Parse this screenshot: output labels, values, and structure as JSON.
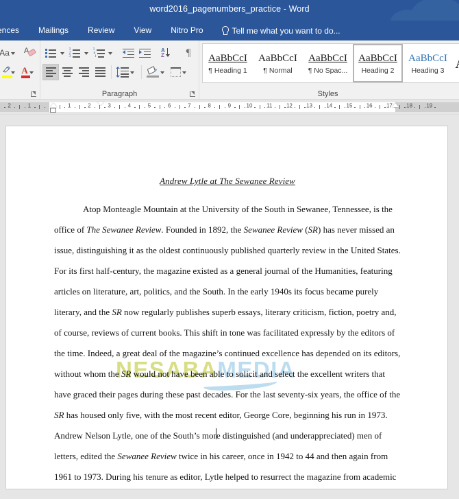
{
  "window": {
    "title": "word2016_pagenumbers_practice - Word"
  },
  "ribbon_tabs": [
    {
      "label": "ences",
      "name": "tab-references"
    },
    {
      "label": "Mailings",
      "name": "tab-mailings"
    },
    {
      "label": "Review",
      "name": "tab-review"
    },
    {
      "label": "View",
      "name": "tab-view"
    },
    {
      "label": "Nitro Pro",
      "name": "tab-nitro-pro"
    }
  ],
  "tell_me": {
    "label": "Tell me what you want to do...",
    "icon": "lightbulb-icon"
  },
  "font_group": {
    "label": "",
    "buttons": [
      {
        "name": "change-case-button",
        "icon": "change-case-icon",
        "label": "Aa"
      },
      {
        "name": "clear-formatting-button",
        "icon": "clear-formatting-icon",
        "label": ""
      },
      {
        "name": "text-highlight-color-button",
        "icon": "highlight-pen-icon",
        "label": ""
      },
      {
        "name": "font-color-button",
        "icon": "font-color-A-icon",
        "label": "A"
      }
    ]
  },
  "paragraph_group": {
    "label": "Paragraph",
    "row1": [
      {
        "name": "bullets-button",
        "icon": "bulleted-list-icon"
      },
      {
        "name": "numbering-button",
        "icon": "numbered-list-icon"
      },
      {
        "name": "multilevel-list-button",
        "icon": "multilevel-list-icon"
      },
      {
        "name": "decrease-indent-button",
        "icon": "decrease-indent-icon"
      },
      {
        "name": "increase-indent-button",
        "icon": "increase-indent-icon"
      },
      {
        "name": "sort-button",
        "icon": "sort-az-icon"
      },
      {
        "name": "show-formatting-marks-button",
        "icon": "pilcrow-icon"
      }
    ],
    "row2": [
      {
        "name": "align-left-button",
        "icon": "align-left-icon",
        "active": true
      },
      {
        "name": "align-center-button",
        "icon": "align-center-icon",
        "active": false
      },
      {
        "name": "align-right-button",
        "icon": "align-right-icon",
        "active": false
      },
      {
        "name": "justify-button",
        "icon": "justify-icon",
        "active": false
      },
      {
        "name": "line-spacing-button",
        "icon": "line-spacing-icon",
        "active": false
      },
      {
        "name": "shading-button",
        "icon": "shading-bucket-icon",
        "active": false
      },
      {
        "name": "borders-button",
        "icon": "borders-icon",
        "active": false
      }
    ]
  },
  "styles_group": {
    "label": "Styles",
    "items": [
      {
        "preview": "AaBbCcI",
        "name": "¶ Heading 1",
        "key": "h1",
        "selected": false
      },
      {
        "preview": "AaBbCcI",
        "name": "¶ Normal",
        "key": "normal",
        "selected": false
      },
      {
        "preview": "AaBbCcI",
        "name": "¶ No Spac...",
        "key": "nospace",
        "selected": false
      },
      {
        "preview": "AaBbCcI",
        "name": "Heading 2",
        "key": "h2",
        "selected": true
      },
      {
        "preview": "AaBbCcI",
        "name": "Heading 3",
        "key": "h3",
        "selected": false
      },
      {
        "preview": "A",
        "name": "",
        "key": "title",
        "selected": false
      }
    ]
  },
  "ruler": {
    "left_labels": [
      "2",
      "1"
    ],
    "right_labels": [
      "1",
      "2",
      "3",
      "4",
      "5",
      "6",
      "7",
      "8",
      "9",
      "10",
      "11",
      "12",
      "13",
      "14",
      "15",
      "16",
      "17",
      "18",
      "19"
    ],
    "markers": [
      "first-line-indent-marker",
      "hanging-indent-marker",
      "left-indent-marker",
      "right-indent-marker"
    ]
  },
  "document": {
    "title": "Andrew Lytle at The Sewanee Review",
    "paragraph_runs": [
      {
        "t": "Atop Monteagle Mountain at the University of the South in Sewanee, Tennessee, is the office of ",
        "i": false
      },
      {
        "t": "The Sewanee Review",
        "i": true
      },
      {
        "t": ". Founded in 1892, the ",
        "i": false
      },
      {
        "t": "Sewanee Review",
        "i": true
      },
      {
        "t": " (",
        "i": false
      },
      {
        "t": "SR",
        "i": true
      },
      {
        "t": ") has never missed an issue, distinguishing it as the oldest continuously published quarterly review in the United States. For its first half-century, the magazine existed as a general journal of the Humanities, featuring articles on literature, art, politics, and the South. In the early 1940s its focus became purely literary, and the ",
        "i": false
      },
      {
        "t": "SR",
        "i": true
      },
      {
        "t": " now regularly publishes superb essays, literary criticism, fiction, poetry and, of course, reviews of current books. This shift in tone was facilitated expressly by the editors of the time. Indeed, a great deal of the magazine’s continued excellence has depended on its editors, without whom the ",
        "i": false
      },
      {
        "t": "SR",
        "i": true
      },
      {
        "t": " would not have been able to solicit and select the excellent writers that have graced their pages during these past decades. For the last seventy-six years, the office of the ",
        "i": false
      },
      {
        "t": "SR",
        "i": true
      },
      {
        "t": " has housed only five, with the most recent editor, George Core, beginning his run in 1973. Andrew Nelson Lytle, one of the South’s more distinguished (and underappreciated) men of letters, edited the ",
        "i": false
      },
      {
        "t": "Sewanee Review",
        "i": true
      },
      {
        "t": " twice in his career, once in 1942 to 44 and then again from 1961 to 1973. During his tenure as editor, Lytle helped to resurrect the magazine from academic",
        "i": false
      }
    ]
  },
  "watermark": {
    "part1": "NESABA",
    "part2": "MEDIA"
  },
  "colors": {
    "titlebar": "#2b579a",
    "ribbon": "#f1f1f1",
    "accent_blue": "#2e74b5",
    "watermark_green": "#d8de85",
    "watermark_blue": "#bcdcef"
  }
}
